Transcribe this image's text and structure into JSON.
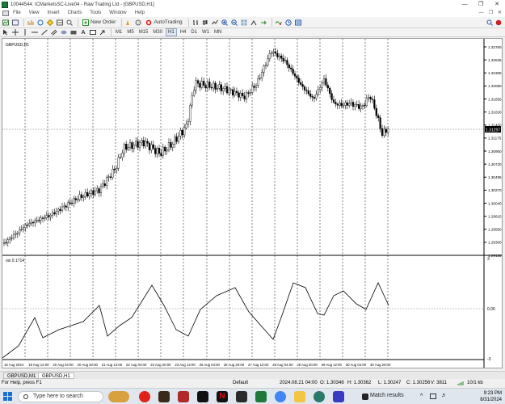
{
  "window": {
    "title": "10044544: ICMarketsSC-Live04 - Raw Trading Ltd - [GBPUSD,H1]",
    "controls": [
      "—",
      "❐",
      "✕"
    ]
  },
  "menu": {
    "items": [
      "File",
      "View",
      "Insert",
      "Charts",
      "Tools",
      "Window",
      "Help"
    ],
    "right_controls": [
      "—",
      "❐",
      "✕"
    ]
  },
  "toolbar": {
    "new_order_label": "New Order",
    "autotrading_label": "AutoTrading"
  },
  "timeframes": [
    "M1",
    "M5",
    "M15",
    "M30",
    "H1",
    "H4",
    "D1",
    "W1",
    "MN"
  ],
  "chart": {
    "label": "GBPUSD,H1",
    "current_price": "1.31297",
    "price_ticks": [
      "1.32760",
      "1.32535",
      "1.32305",
      "1.32080",
      "1.31855",
      "1.31630",
      "1.31400",
      "1.31175",
      "1.30950",
      "1.30720",
      "1.30495",
      "1.30270",
      "1.30040",
      "1.29815",
      "1.29590",
      "1.29360",
      "1.29135"
    ],
    "time_labels": [
      "16 Aug 2024",
      "19 Aug 12:00",
      "20 Aug 04:00",
      "20 Aug 20:00",
      "21 Aug 12:00",
      "22 Aug 04:00",
      "22 Aug 20:00",
      "23 Aug 12:00",
      "26 Aug 04:00",
      "26 Aug 20:00",
      "27 Aug 12:00",
      "28 Aug 04:00",
      "28 Aug 20:00",
      "29 Aug 12:00",
      "30 Aug 04:00",
      "30 Aug 20:00"
    ],
    "indicator_label": "osi 0.1714",
    "indicator_ticks": [
      "3",
      "0.00",
      "-3"
    ],
    "colors": {
      "candle": "#000000",
      "grid": "#000000",
      "current_line": "#b0b0b0",
      "oscillator": "#000000"
    }
  },
  "tabs": [
    {
      "label": "GBPUSD,M1",
      "active": false
    },
    {
      "label": "GBPUSD,H1",
      "active": true
    }
  ],
  "status": {
    "help": "For Help, press F1",
    "profile": "Default",
    "datetime": "2024.08.21 04:00",
    "open": "O: 1.30346",
    "high": "H: 1.30362",
    "low": "L: 1.30247",
    "close": "C: 1.30256",
    "volume": "V: 3811",
    "traffic": "10/1 kb"
  },
  "taskbar": {
    "search_placeholder": "Type here to search",
    "match_results": "Match results",
    "time": "9:23 PM",
    "date": "8/31/2024"
  }
}
